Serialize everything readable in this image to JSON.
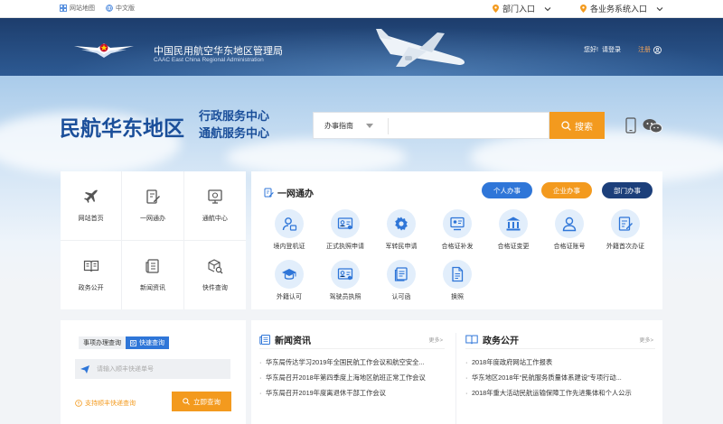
{
  "topbar": {
    "sitemap": "网站地图",
    "lang": "中文版",
    "dept_entry": "部门入口",
    "biz_entry": "各业务系统入口"
  },
  "header": {
    "org_cn": "中国民用航空华东地区管理局",
    "org_en": "CAAC East China Regional Administration",
    "hello": "您好!",
    "login": "请登录",
    "register": "注册"
  },
  "hero": {
    "brand": "民航华东地区",
    "sub1": "行政服务中心",
    "sub2": "通航服务中心",
    "search_category": "办事指南",
    "search_btn": "搜索"
  },
  "nav": [
    {
      "label": "网站首页",
      "icon": "plane-icon"
    },
    {
      "label": "一网通办",
      "icon": "edit-icon"
    },
    {
      "label": "通航中心",
      "icon": "screen-icon"
    },
    {
      "label": "政务公开",
      "icon": "book-icon"
    },
    {
      "label": "新闻资讯",
      "icon": "news-icon"
    },
    {
      "label": "快件查询",
      "icon": "package-search-icon"
    }
  ],
  "onestop": {
    "title": "一网通办",
    "btn_personal": "个人办事",
    "btn_company": "企业办事",
    "btn_dept": "部门办事",
    "services": [
      "境内登机证",
      "正式执照申请",
      "军转民申请",
      "合格证补发",
      "合格证变更",
      "合格证账号",
      "外籍首次办证",
      "外籍认可",
      "驾驶员执照",
      "认可函",
      "换照"
    ]
  },
  "query": {
    "tab1": "事项办理查询",
    "tab2": "快速查询",
    "placeholder": "请输入顺丰快递单号",
    "hint": "支持顺丰快递查询",
    "btn": "立即查询"
  },
  "news": {
    "title": "新闻资讯",
    "more": "更多>",
    "items": [
      "华东局传达学习2019年全国民航工作会议和航空安全...",
      "华东局召开2018年第四季度上海地区航班正常工作会议",
      "华东局召开2019年度离退休干部工作会议"
    ]
  },
  "gov": {
    "title": "政务公开",
    "more": "更多>",
    "items": [
      "2018年度政府网站工作报表",
      "华东地区2018年“民航服务质量体系建设”专项行动...",
      "2018年重大活动民航运输保障工作先进集体和个人公示"
    ]
  },
  "colors": {
    "primary": "#2f76d8",
    "accent": "#f39a1e",
    "navy": "#1c3f7a"
  }
}
